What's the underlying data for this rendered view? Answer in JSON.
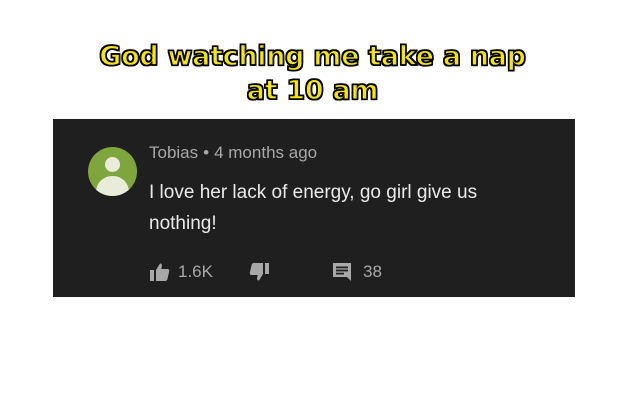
{
  "caption": {
    "line1": "God watching me take a nap",
    "line2": "at 10 am"
  },
  "comment": {
    "author": "Tobias",
    "separator": "•",
    "time": "4 months ago",
    "text": "I love her lack of energy, go girl give us nothing!",
    "likes": "1.6K",
    "replies": "38"
  },
  "icons": {
    "avatar": "default-user-avatar-icon",
    "like": "thumbs-up-icon",
    "dislike": "thumbs-down-icon",
    "reply": "comment-bubble-icon"
  },
  "colors": {
    "caption_fill": "#f6e600",
    "caption_stroke": "#000000",
    "card_background": "#1f1f1f",
    "avatar_background": "#7ea63c",
    "meta_text": "#a8a8a8",
    "comment_text": "#eaeaea"
  }
}
